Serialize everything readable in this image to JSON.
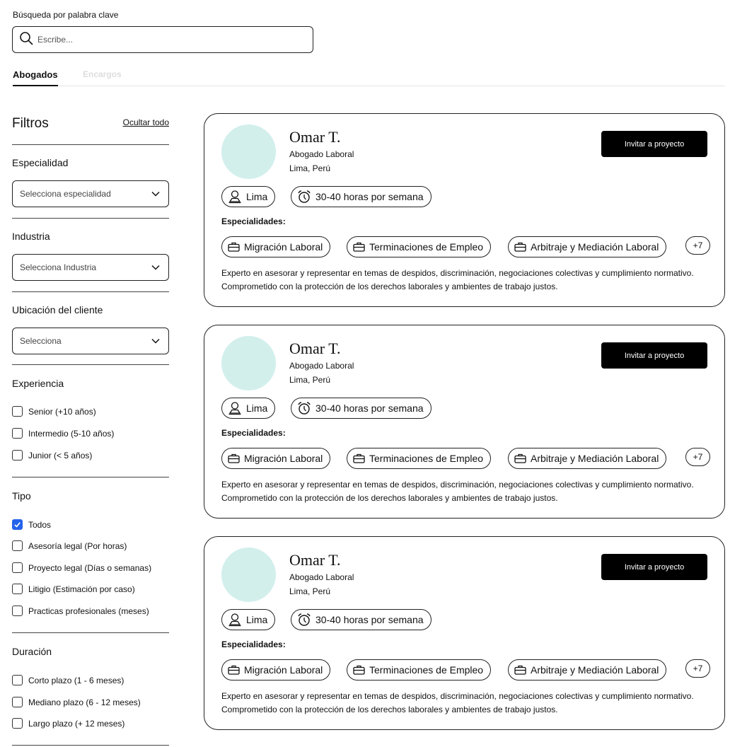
{
  "search": {
    "label": "Búsqueda por palabra clave",
    "placeholder": "Escribe..."
  },
  "tabs": [
    {
      "label": "Abogados",
      "active": true
    },
    {
      "label": "Encargos",
      "active": false
    }
  ],
  "filters": {
    "title": "Filtros",
    "hide_all": "Ocultar todo",
    "specialty": {
      "title": "Especialidad",
      "placeholder": "Selecciona especialidad"
    },
    "industry": {
      "title": "Industria",
      "placeholder": "Selecciona Industria"
    },
    "client_location": {
      "title": "Ubicación del cliente",
      "placeholder": "Selecciona"
    },
    "experience": {
      "title": "Experiencia",
      "options": [
        {
          "label": "Senior (+10 años)",
          "checked": false
        },
        {
          "label": "Intermedio (5-10 años)",
          "checked": false
        },
        {
          "label": "Junior (< 5 años)",
          "checked": false
        }
      ]
    },
    "type": {
      "title": "Tipo",
      "options": [
        {
          "label": "Todos",
          "checked": true
        },
        {
          "label": "Asesoría legal (Por horas)",
          "checked": false
        },
        {
          "label": "Proyecto legal (Días o semanas)",
          "checked": false
        },
        {
          "label": "Litigio (Estimación por caso)",
          "checked": false
        },
        {
          "label": "Practicas profesionales (meses)",
          "checked": false
        }
      ]
    },
    "duration": {
      "title": "Duración",
      "options": [
        {
          "label": "Corto plazo (1 - 6 meses)",
          "checked": false
        },
        {
          "label": "Mediano plazo (6 - 12 meses)",
          "checked": false
        },
        {
          "label": "Largo plazo (+ 12 meses)",
          "checked": false
        }
      ]
    }
  },
  "lawyers": [
    {
      "name": "Omar T.",
      "role": "Abogado Laboral",
      "location": "Lima, Perú",
      "city_tag": "Lima",
      "hours_tag": "30-40 horas por semana",
      "invite_label": "Invitar a proyecto",
      "specialties_title": "Especialidades:",
      "specialties": [
        "Migración Laboral",
        "Terminaciones de Empleo",
        "Arbitraje y Mediación Laboral"
      ],
      "more_count": "+7",
      "description": "Experto en asesorar y representar en temas de despidos, discriminación, negociaciones colectivas y cumplimiento normativo. Comprometido con la protección de los derechos laborales y ambientes de trabajo justos."
    },
    {
      "name": "Omar T.",
      "role": "Abogado Laboral",
      "location": "Lima, Perú",
      "city_tag": "Lima",
      "hours_tag": "30-40 horas por semana",
      "invite_label": "Invitar a proyecto",
      "specialties_title": "Especialidades:",
      "specialties": [
        "Migración Laboral",
        "Terminaciones de Empleo",
        "Arbitraje y Mediación Laboral"
      ],
      "more_count": "+7",
      "description": "Experto en asesorar y representar en temas de despidos, discriminación, negociaciones colectivas y cumplimiento normativo. Comprometido con la protección de los derechos laborales y ambientes de trabajo justos."
    },
    {
      "name": "Omar T.",
      "role": "Abogado Laboral",
      "location": "Lima, Perú",
      "city_tag": "Lima",
      "hours_tag": "30-40 horas por semana",
      "invite_label": "Invitar a proyecto",
      "specialties_title": "Especialidades:",
      "specialties": [
        "Migración Laboral",
        "Terminaciones de Empleo",
        "Arbitraje y Mediación Laboral"
      ],
      "more_count": "+7",
      "description": "Experto en asesorar y representar en temas de despidos, discriminación, negociaciones colectivas y cumplimiento normativo. Comprometido con la protección de los derechos laborales y ambientes de trabajo justos."
    }
  ],
  "colors": {
    "avatar": "#d2efec",
    "checkbox_checked": "#2563eb",
    "button": "#000000"
  },
  "icons": [
    "search-icon",
    "chevron-down-icon",
    "checkmark-icon",
    "person-pin-icon",
    "alarm-clock-icon",
    "briefcase-icon"
  ]
}
